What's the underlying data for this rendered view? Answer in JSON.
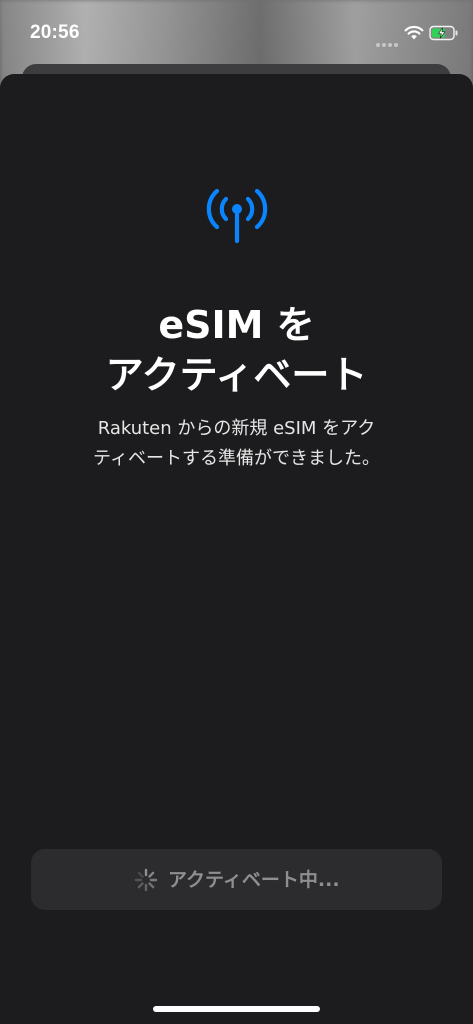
{
  "status_bar": {
    "time": "20:56",
    "icons": [
      "signal-dots-icon",
      "wifi-icon",
      "battery-charging-icon"
    ],
    "battery_color": "#30d158"
  },
  "main": {
    "icon": "cellular-antenna-icon",
    "icon_color": "#0a84ff",
    "title_lines": [
      "eSIM を",
      "アクティベート"
    ],
    "description_lines": [
      "Rakuten からの新規 eSIM をアク",
      "ティベートする準備ができました。"
    ]
  },
  "button": {
    "icon": "spinner-icon",
    "label": "アクティベート中..."
  }
}
